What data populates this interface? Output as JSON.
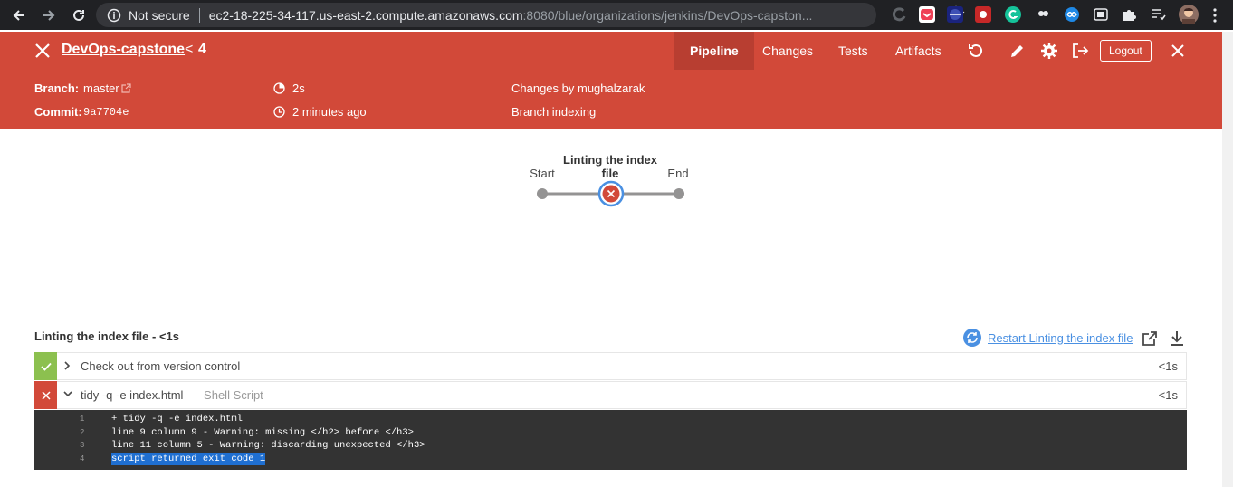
{
  "browser": {
    "security_label": "Not secure",
    "url_host": "ec2-18-225-34-117.us-east-2.compute.amazonaws.com",
    "url_path": ":8080/blue/organizations/jenkins/DevOps-capston..."
  },
  "header": {
    "title": "DevOps-capstone",
    "run_separator": "<",
    "run_number": "4",
    "tabs": [
      {
        "label": "Pipeline",
        "active": true
      },
      {
        "label": "Changes",
        "active": false
      },
      {
        "label": "Tests",
        "active": false
      },
      {
        "label": "Artifacts",
        "active": false
      }
    ],
    "logout_label": "Logout"
  },
  "summary": {
    "branch_label": "Branch:",
    "branch_value": "master",
    "commit_label": "Commit:",
    "commit_value": "9a7704e",
    "duration": "2s",
    "time_ago": "2 minutes ago",
    "changes": "Changes by mughalzarak",
    "cause": "Branch indexing"
  },
  "pipeline_graph": {
    "start_label": "Start",
    "stage_label_line1": "Linting the index",
    "stage_label_line2": "file",
    "end_label": "End",
    "stage_status": "failed"
  },
  "steps": {
    "title": "Linting the index file - <1s",
    "restart_label": "Restart Linting the index file",
    "items": [
      {
        "name": "Check out from version control",
        "type": "",
        "duration": "<1s",
        "status": "success"
      },
      {
        "name": "tidy -q -e index.html",
        "type": "— Shell Script",
        "duration": "<1s",
        "status": "failed"
      }
    ]
  },
  "log": {
    "lines": [
      {
        "num": "1",
        "text": "+ tidy -q -e index.html"
      },
      {
        "num": "2",
        "text": "line 9 column 9 - Warning: missing </h2> before </h3>"
      },
      {
        "num": "3",
        "text": "line 11 column 5 - Warning: discarding unexpected </h3>"
      },
      {
        "num": "4",
        "text": "script returned exit code 1",
        "highlighted": true
      }
    ]
  },
  "colors": {
    "header_red": "#d24939",
    "success_green": "#8cc04f",
    "failed_red": "#d24939",
    "link_blue": "#4a90e2"
  }
}
